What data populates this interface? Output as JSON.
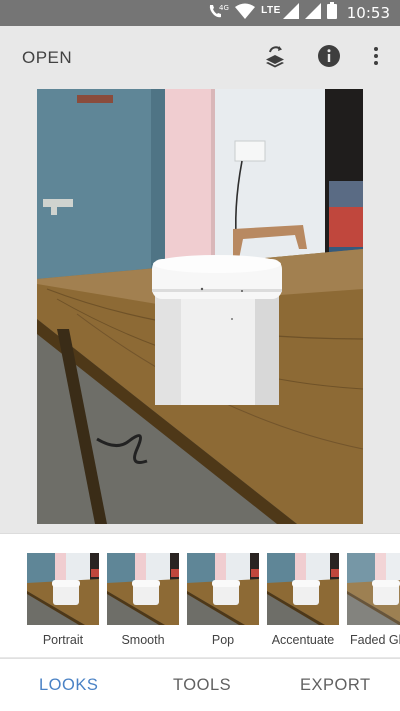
{
  "status_bar": {
    "time": "10:53",
    "network": "LTE",
    "call_badge": "4G"
  },
  "app_bar": {
    "open_label": "OPEN",
    "icons": [
      "layers-edit-icon",
      "info-icon",
      "more-vert-icon"
    ]
  },
  "looks": {
    "items": [
      {
        "label": "Portrait"
      },
      {
        "label": "Smooth"
      },
      {
        "label": "Pop"
      },
      {
        "label": "Accentuate"
      },
      {
        "label": "Faded Gl"
      }
    ]
  },
  "bottom_nav": {
    "looks_label": "LOOKS",
    "tools_label": "TOOLS",
    "export_label": "EXPORT",
    "active": "LOOKS"
  },
  "colors": {
    "accent": "#4a82c5",
    "status_bar": "#757575",
    "app_background": "#e8e8e8"
  }
}
